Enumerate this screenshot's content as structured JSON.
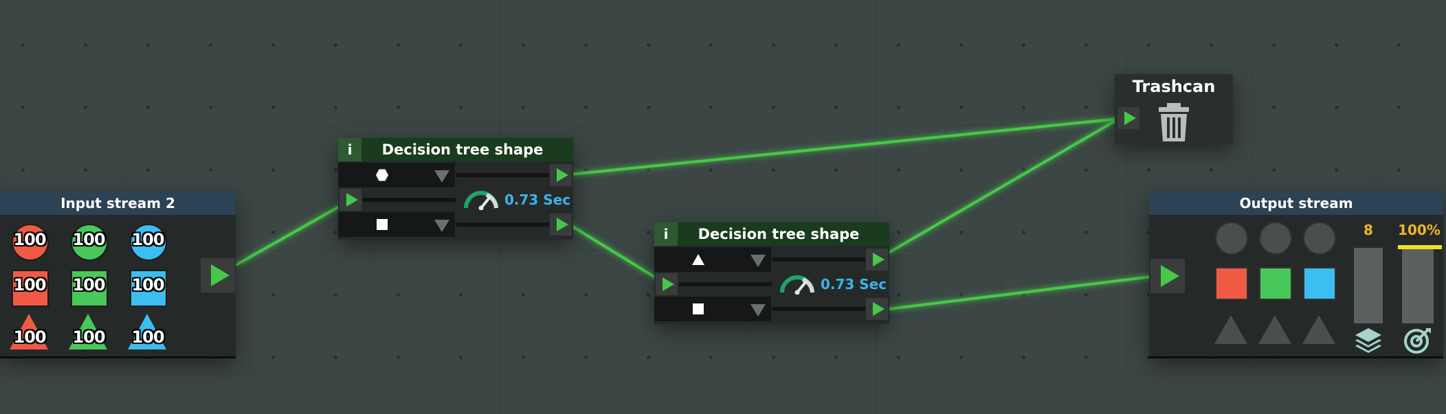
{
  "input_node": {
    "title": "Input stream 2",
    "items": [
      {
        "shape": "circle",
        "color": "#f05a45",
        "count": "100"
      },
      {
        "shape": "circle",
        "color": "#48c85a",
        "count": "100"
      },
      {
        "shape": "circle",
        "color": "#3cbef0",
        "count": "100"
      },
      {
        "shape": "square",
        "color": "#f05a45",
        "count": "100"
      },
      {
        "shape": "square",
        "color": "#48c85a",
        "count": "100"
      },
      {
        "shape": "square",
        "color": "#3cbef0",
        "count": "100"
      },
      {
        "shape": "triangle",
        "color": "#f05a45",
        "count": "100"
      },
      {
        "shape": "triangle",
        "color": "#48c85a",
        "count": "100"
      },
      {
        "shape": "triangle",
        "color": "#3cbef0",
        "count": "100"
      }
    ]
  },
  "decision_node_1": {
    "info": "i",
    "title": "Decision tree shape",
    "top_shape": "hexagon",
    "bottom_shape": "square",
    "speed": "0.73 Sec"
  },
  "decision_node_2": {
    "info": "i",
    "title": "Decision tree shape",
    "top_shape": "triangle",
    "bottom_shape": "square",
    "speed": "0.73 Sec"
  },
  "trashcan": {
    "title": "Trashcan"
  },
  "output_node": {
    "title": "Output stream",
    "count_label": "8",
    "percent_label": "100%",
    "slots": [
      {
        "shape": "circle",
        "color": "#4a4f4e"
      },
      {
        "shape": "circle",
        "color": "#4a4f4e"
      },
      {
        "shape": "circle",
        "color": "#4a4f4e"
      },
      {
        "shape": "square",
        "color": "#f05a45"
      },
      {
        "shape": "square",
        "color": "#48c85a"
      },
      {
        "shape": "square",
        "color": "#3cbef0"
      },
      {
        "shape": "triangle",
        "color": "#4a4f4e"
      },
      {
        "shape": "triangle",
        "color": "#4a4f4e"
      },
      {
        "shape": "triangle",
        "color": "#4a4f4e"
      }
    ],
    "accuracy_fill": 1.0
  },
  "colors": {
    "wire": "#46c84a",
    "port_arrow": "#46c84a",
    "speed_text": "#3cb4e8",
    "gauge_label": "#f0b52a",
    "accuracy_bar": "#f2e21b"
  }
}
